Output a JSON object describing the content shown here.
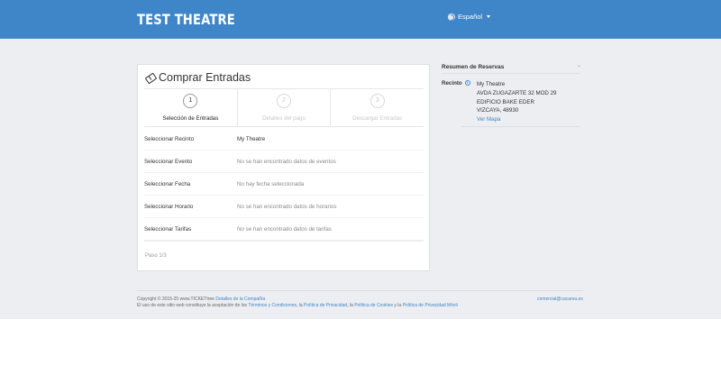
{
  "header": {
    "brand": "TEST THEATRE",
    "language": "Español"
  },
  "card": {
    "title": "Comprar Entradas",
    "steps": [
      {
        "number": "1",
        "label": "Selección de Entradas",
        "active": true
      },
      {
        "number": "2",
        "label": "Detalles del pago",
        "active": false
      },
      {
        "number": "3",
        "label": "Descargar Entradas",
        "active": false
      }
    ],
    "rows": [
      {
        "label": "Seleccionar Recinto",
        "value": "My Theatre"
      },
      {
        "label": "Seleccionar Evento",
        "value": "No se han encontrado datos de eventos"
      },
      {
        "label": "Seleccionar Fecha",
        "value": "No hay fecha seleccionada"
      },
      {
        "label": "Seleccionar Horario",
        "value": "No se han encontrado datos de horarios"
      },
      {
        "label": "Seleccionar Tarifas",
        "value": "No se han encontrado datos de tarifas"
      }
    ],
    "pager": "Paso 1/3"
  },
  "summary": {
    "title": "Resumen de Reservas",
    "venue_label": "Recinto",
    "venue_name": "My Theatre",
    "address1": "AVDA ZUGAZARTE 32 MOD 29",
    "address2": "EDIFICIO BAKE EDER",
    "address3": "VIZCAYA, 48930",
    "map_link": "Ver Mapa"
  },
  "footer": {
    "copyright": "Copyright © 2015-25 www.TICKETtree",
    "company_link": "Detalles de la Compañía",
    "terms_prefix": "El uso de este sitio web constituye la aceptación de los",
    "terms_link": "Términos y Condiciones",
    "privacy_link": "Política de Privacidad",
    "cookies_link": "Política de Cookies",
    "mobile_privacy_link": "Política de Privacidad Móvil",
    "email": "comercial@cacareu.es"
  }
}
